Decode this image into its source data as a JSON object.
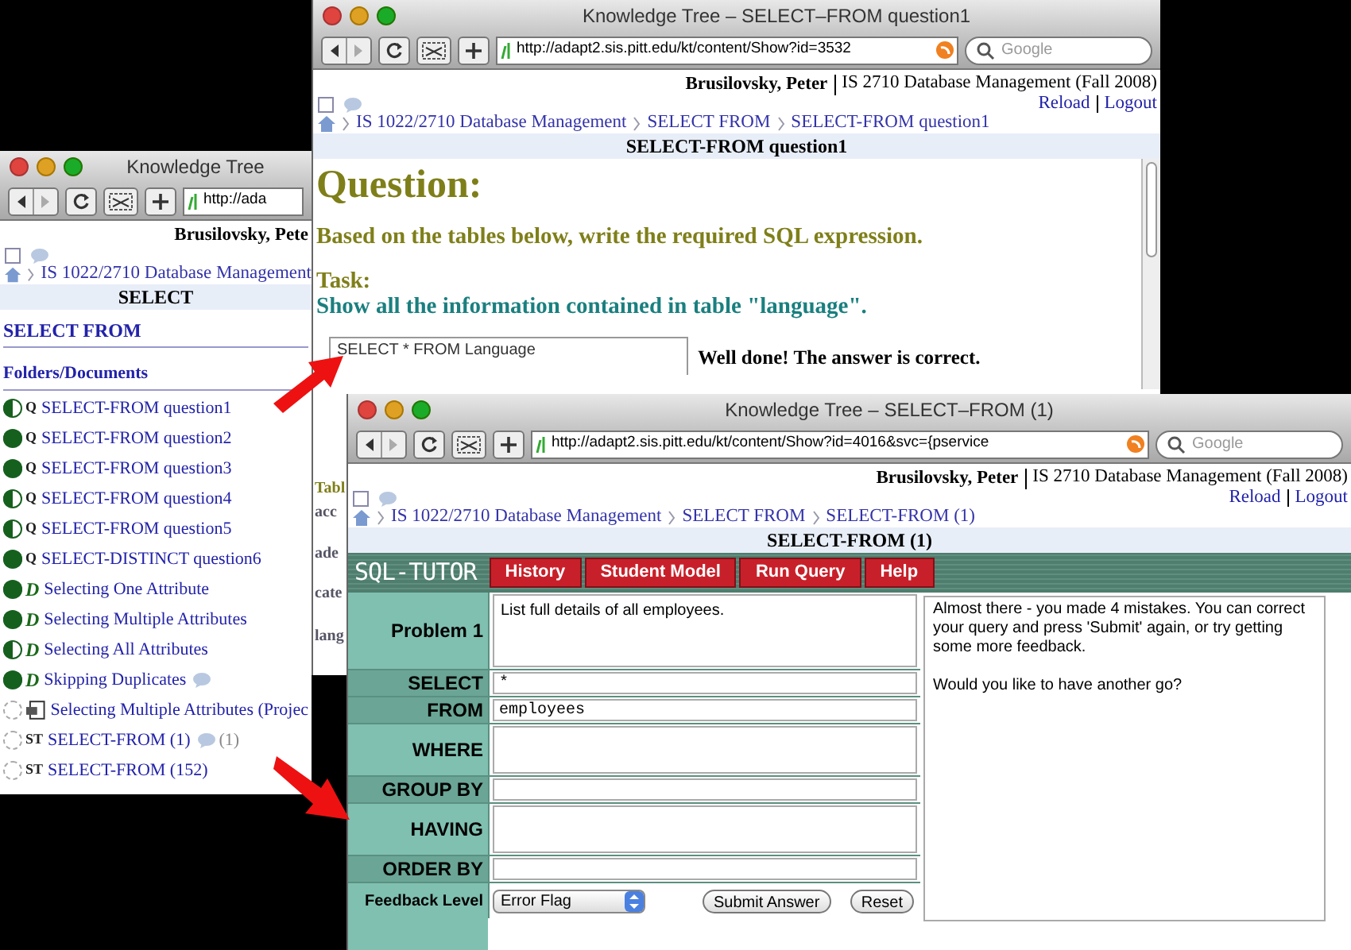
{
  "back_window": {
    "title": "Knowledge Tree",
    "url": "http://ada",
    "user_name": "Brusilovsky, Pete",
    "breadcrumb": [
      "IS 1022/2710 Database Management"
    ],
    "heading": "SELECT",
    "section": "SELECT FROM",
    "list_title": "Folders/Documents",
    "items": [
      {
        "kind": "question",
        "badge": "Q",
        "label": "SELECT-FROM question1",
        "level": 0.5,
        "comments": false
      },
      {
        "kind": "question",
        "badge": "Q",
        "label": "SELECT-FROM question2",
        "level": 1,
        "comments": false
      },
      {
        "kind": "question",
        "badge": "Q",
        "label": "SELECT-FROM question3",
        "level": 1,
        "comments": false
      },
      {
        "kind": "question",
        "badge": "Q",
        "label": "SELECT-FROM question4",
        "level": 0.5,
        "comments": false
      },
      {
        "kind": "question",
        "badge": "Q",
        "label": "SELECT-FROM question5",
        "level": 0.5,
        "comments": false
      },
      {
        "kind": "question",
        "badge": "Q",
        "label": "SELECT-DISTINCT question6",
        "level": 1,
        "comments": false
      },
      {
        "kind": "reading",
        "badge": "D",
        "label": "Selecting One Attribute",
        "level": 1,
        "comments": false
      },
      {
        "kind": "reading",
        "badge": "D",
        "label": "Selecting Multiple Attributes",
        "level": 1,
        "comments": false
      },
      {
        "kind": "reading",
        "badge": "D",
        "label": "Selecting All Attributes",
        "level": 0.5,
        "comments": false
      },
      {
        "kind": "reading",
        "badge": "D",
        "label": "Skipping Duplicates",
        "level": 1,
        "comments": true
      },
      {
        "kind": "document",
        "label": "Selecting Multiple Attributes (Projec",
        "level": 0,
        "comments": false
      },
      {
        "kind": "tutor",
        "badge": "ST",
        "label": "SELECT-FROM (1)",
        "level": 0,
        "comments": true,
        "comment_count": "(1)"
      },
      {
        "kind": "tutor",
        "badge": "ST",
        "label": "SELECT-FROM (152)",
        "level": 0,
        "comments": false
      }
    ]
  },
  "middle_window": {
    "title": "Knowledge Tree – SELECT–FROM question1",
    "url": "http://adapt2.sis.pitt.edu/kt/content/Show?id=3532",
    "search_placeholder": "Google",
    "user_name": "Brusilovsky, Peter",
    "course": "IS 2710 Database Management (Fall 2008)",
    "links": [
      "Reload",
      "Logout"
    ],
    "breadcrumb": [
      "IS 1022/2710 Database Management",
      "SELECT FROM",
      "SELECT-FROM question1"
    ],
    "heading": "SELECT-FROM question1",
    "question_title": "Question:",
    "instruction": "Based on the tables below, write the required SQL expression.",
    "task_label": "Task:",
    "task": "Show all the information contained in table \"language\".",
    "answer": "SELECT * FROM Language",
    "result": "Well done! The answer is correct.",
    "fragments": [
      "Tabl",
      "acc",
      "ade",
      "cate",
      "lang"
    ]
  },
  "front_window": {
    "title": "Knowledge Tree – SELECT–FROM (1)",
    "url": "http://adapt2.sis.pitt.edu/kt/content/Show?id=4016&svc={pservice",
    "search_placeholder": "Google",
    "user_name": "Brusilovsky, Peter",
    "course": "IS 2710 Database Management (Fall 2008)",
    "links": [
      "Reload",
      "Logout"
    ],
    "breadcrumb": [
      "IS 1022/2710 Database Management",
      "SELECT FROM",
      "SELECT-FROM (1)"
    ],
    "heading": "SELECT-FROM (1)",
    "logo": "SQL-TUTOR",
    "menu": [
      "History",
      "Student Model",
      "Run Query",
      "Help"
    ],
    "problem_label": "Problem 1",
    "problem": "List full details of all employees.",
    "clauses": [
      {
        "label": "SELECT",
        "kind": "line",
        "value": "*"
      },
      {
        "label": "FROM",
        "kind": "line",
        "value": "employees"
      },
      {
        "label": "WHERE",
        "kind": "area"
      },
      {
        "label": "GROUP BY",
        "kind": "line"
      },
      {
        "label": "HAVING",
        "kind": "area"
      },
      {
        "label": "ORDER BY",
        "kind": "line"
      }
    ],
    "feedback_label": "Feedback Level",
    "feedback_level": "Error Flag",
    "buttons": [
      "Submit Answer",
      "Reset"
    ],
    "feedback": [
      "Almost there - you made 4 mistakes. You can correct your query and press 'Submit' again, or try getting some more feedback.",
      "Would you like to have another go?"
    ]
  }
}
